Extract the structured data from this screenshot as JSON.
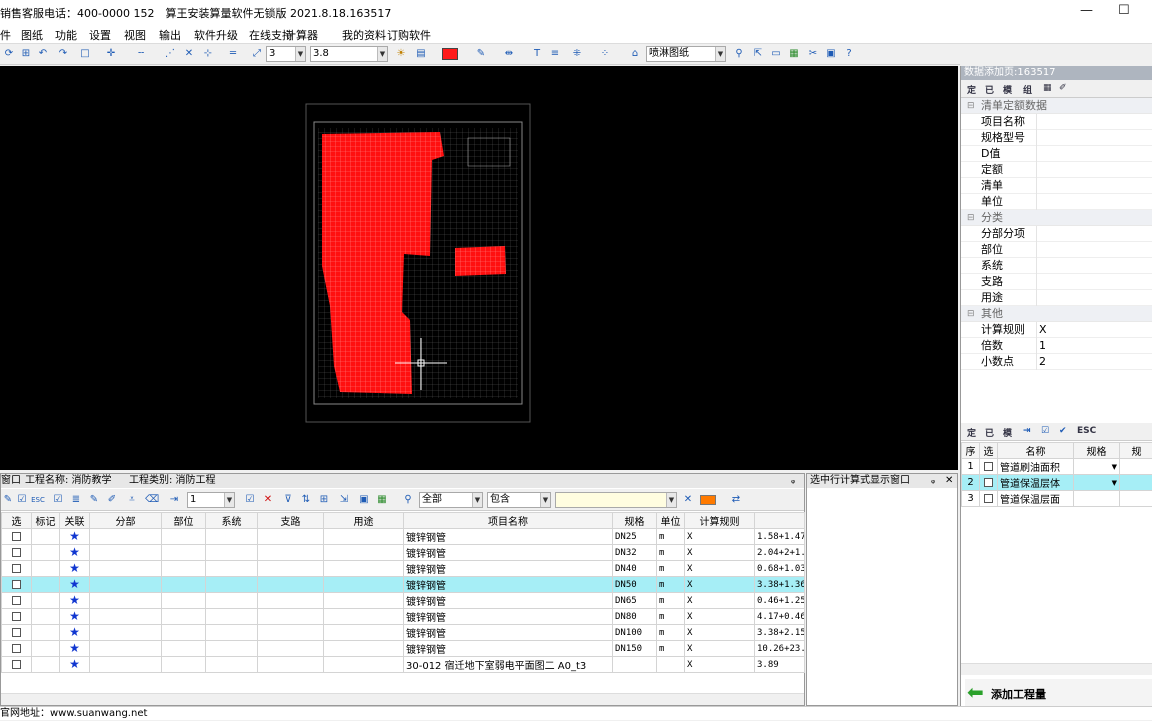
{
  "app": {
    "title": "销售客服电话：400-0000 152　算王安装算量软件无锁版 2021.8.18.163517",
    "minimize": "—",
    "maximize": "☐"
  },
  "menu": [
    "件",
    "图纸",
    "功能",
    "设置",
    "视图",
    "输出",
    "软件升级",
    "在线支持",
    "计算器",
    "我的资料",
    "订购软件"
  ],
  "toolbar": {
    "layer_value": "3",
    "scale_value": "3.8",
    "drawing_value": "喷淋图纸",
    "accent_color": "#ff1a1a"
  },
  "right_panel": {
    "title": "数据添加页:163517",
    "tools": [
      "定",
      "已",
      "模",
      "组"
    ],
    "sections": [
      {
        "label": "清单定额数据",
        "rows": [
          {
            "key": "项目名称",
            "value": ""
          },
          {
            "key": "规格型号",
            "value": ""
          },
          {
            "key": "D值",
            "value": ""
          },
          {
            "key": "定额",
            "value": ""
          },
          {
            "key": "清单",
            "value": ""
          },
          {
            "key": "单位",
            "value": ""
          }
        ]
      },
      {
        "label": "分类",
        "rows": [
          {
            "key": "分部分项",
            "value": ""
          },
          {
            "key": "部位",
            "value": ""
          },
          {
            "key": "系统",
            "value": ""
          },
          {
            "key": "支路",
            "value": ""
          },
          {
            "key": "用途",
            "value": ""
          }
        ]
      },
      {
        "label": "其他",
        "rows": [
          {
            "key": "计算规则",
            "value": "X"
          },
          {
            "key": "倍数",
            "value": "1"
          },
          {
            "key": "小数点",
            "value": "2"
          }
        ]
      }
    ]
  },
  "right_list": {
    "tools": [
      "定",
      "已",
      "模"
    ],
    "headers": [
      "序",
      "选",
      "名称",
      "规格",
      "规"
    ],
    "rows": [
      {
        "no": "1",
        "name": "管道刷油面积"
      },
      {
        "no": "2",
        "name": "管道保温层体"
      },
      {
        "no": "3",
        "name": "管道保温层面"
      }
    ],
    "add_button": "添加工程量"
  },
  "bottom": {
    "window_label": "窗口",
    "project_name": "工程名称: 消防教学",
    "project_type": "工程类别: 消防工程",
    "pin": "ᵩ",
    "filter_num": "1",
    "filter_scope": "全部",
    "filter_mode": "包含",
    "headers": [
      "选",
      "标记",
      "关联",
      "分部",
      "部位",
      "系统",
      "支路",
      "用途",
      "项目名称",
      "规格",
      "单位",
      "计算规则",
      ""
    ],
    "rows": [
      {
        "name": "镀锌钢管",
        "spec": "DN25",
        "unit": "m",
        "rule": "X",
        "formula": "1.58+1.47"
      },
      {
        "name": "镀锌钢管",
        "spec": "DN32",
        "unit": "m",
        "rule": "X",
        "formula": "2.04+2+1."
      },
      {
        "name": "镀锌钢管",
        "spec": "DN40",
        "unit": "m",
        "rule": "X",
        "formula": "0.68+1.03"
      },
      {
        "name": "镀锌钢管",
        "spec": "DN50",
        "unit": "m",
        "rule": "X",
        "formula": "3.38+1.36"
      },
      {
        "name": "镀锌钢管",
        "spec": "DN65",
        "unit": "m",
        "rule": "X",
        "formula": "0.46+1.25"
      },
      {
        "name": "镀锌钢管",
        "spec": "DN80",
        "unit": "m",
        "rule": "X",
        "formula": "4.17+0.46"
      },
      {
        "name": "镀锌钢管",
        "spec": "DN100",
        "unit": "m",
        "rule": "X",
        "formula": "3.38+2.15"
      },
      {
        "name": "镀锌钢管",
        "spec": "DN150",
        "unit": "m",
        "rule": "X",
        "formula": "10.26+23."
      },
      {
        "name": "30-012 宿迁地下室弱电平面图二 A0_t3",
        "spec": "",
        "unit": "",
        "rule": "X",
        "formula": "3.89"
      }
    ],
    "selected_row": 3
  },
  "formula_panel": {
    "title": "选中行计算式显示窗口",
    "pin": "ᵩ",
    "close": "✕"
  },
  "status": {
    "text": "官网地址：www.suanwang.net"
  }
}
